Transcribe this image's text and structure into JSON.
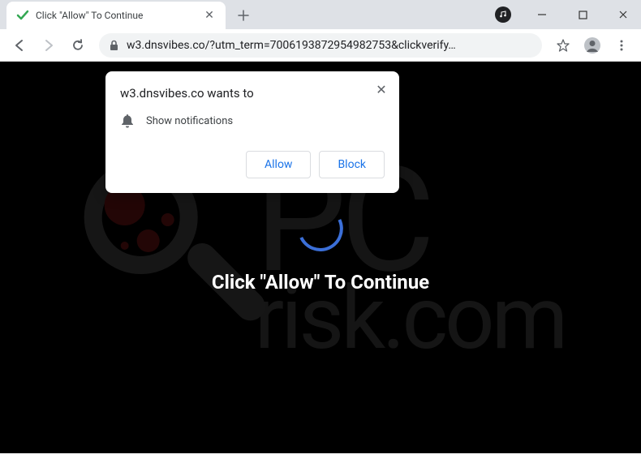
{
  "window": {
    "min": "—",
    "max": "☐",
    "close": "✕"
  },
  "tab": {
    "title": "Click \"Allow\" To Continue",
    "close": "✕"
  },
  "toolbar": {
    "url": "w3.dnsvibes.co/?utm_term=7006193872954982753&clickverify…"
  },
  "dialog": {
    "title": "w3.dnsvibes.co wants to",
    "permission": "Show notifications",
    "allow": "Allow",
    "block": "Block",
    "close": "✕"
  },
  "page": {
    "message": "Click \"Allow\" To Continue"
  },
  "watermark": {
    "line1": "PC",
    "line2": "risk.com"
  }
}
